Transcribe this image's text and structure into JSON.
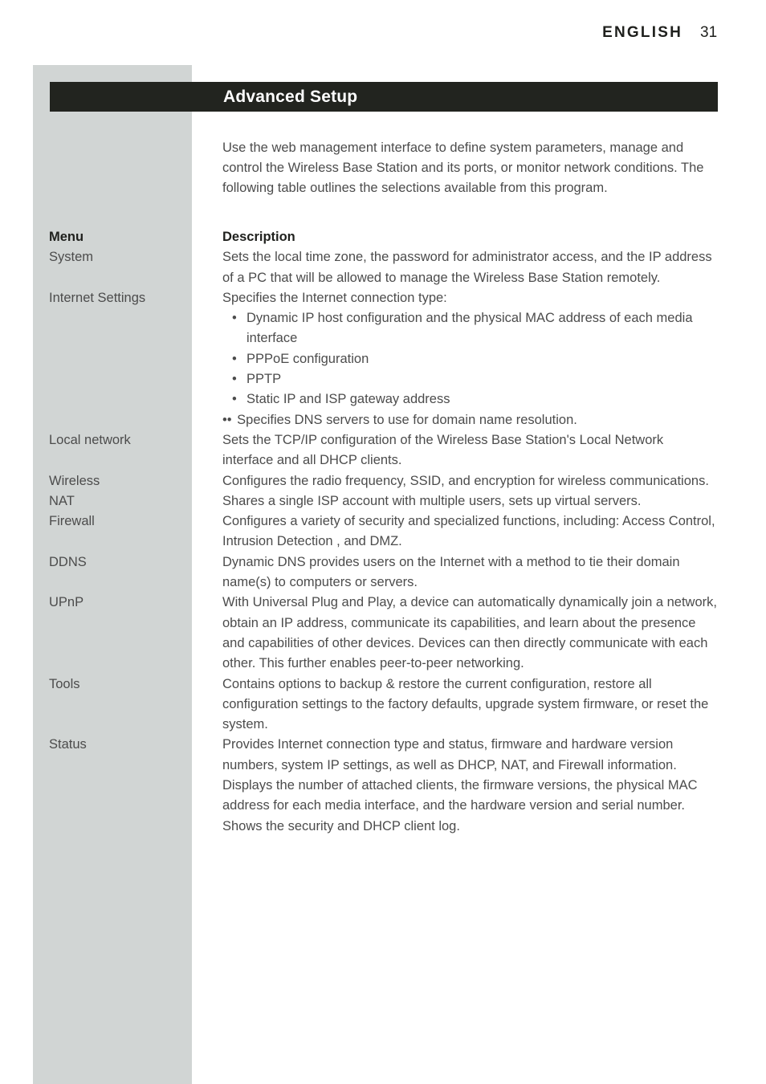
{
  "header": {
    "language": "ENGLISH",
    "page_number": "31"
  },
  "title_bar": {
    "title": "Advanced Setup"
  },
  "intro": {
    "text": "Use the web management interface to define system parameters, manage and control the Wireless Base Station and its ports, or monitor network conditions. The following table outlines the selections available from this program."
  },
  "table": {
    "columns": {
      "menu": "Menu",
      "description": "Description"
    },
    "rows": [
      {
        "menu": "System",
        "paragraphs": [
          "Sets the local time zone, the password for administrator access, and the IP address of a PC that will be allowed to manage the Wireless Base Station remotely."
        ]
      },
      {
        "menu": "Internet Settings",
        "paragraphs": [
          "Specifies the Internet connection type:"
        ],
        "bullets": [
          {
            "marker": "•",
            "text": "Dynamic IP host configuration and the physical MAC address of each media interface",
            "flush": false
          },
          {
            "marker": "•",
            "text": "PPPoE configuration",
            "flush": false
          },
          {
            "marker": "•",
            "text": "PPTP",
            "flush": false
          },
          {
            "marker": "•",
            "text": "Static IP and ISP gateway address",
            "flush": false
          },
          {
            "marker": "••",
            "text": "Specifies DNS servers to use for domain name resolution.",
            "flush": true
          }
        ]
      },
      {
        "menu": "Local network",
        "paragraphs": [
          "Sets the TCP/IP configuration of the Wireless Base Station's Local Network interface and all DHCP clients."
        ]
      },
      {
        "menu": "Wireless",
        "paragraphs": [
          "Configures the radio frequency, SSID, and encryption for wireless communications."
        ]
      },
      {
        "menu": "NAT",
        "paragraphs": [
          "Shares a single ISP account with multiple users, sets up virtual servers."
        ]
      },
      {
        "menu": "Firewall",
        "paragraphs": [
          "Configures a variety of security and specialized functions, including: Access Control, Intrusion Detection , and DMZ."
        ]
      },
      {
        "menu": "DDNS",
        "paragraphs": [
          "Dynamic DNS provides users on the Internet with a method to tie their domain name(s) to computers or servers."
        ]
      },
      {
        "menu": "UPnP",
        "paragraphs": [
          "With Universal Plug and Play, a device can automatically dynamically join a network, obtain an IP address, communicate its capabilities, and learn about the presence and capabilities of other devices. Devices can then directly communicate with each other. This further enables peer-to-peer networking."
        ]
      },
      {
        "menu": "Tools",
        "paragraphs": [
          "Contains options to backup & restore the current configuration, restore all configuration settings to the factory defaults, upgrade system firmware, or reset the system."
        ]
      },
      {
        "menu": "Status",
        "paragraphs": [
          "Provides Internet connection type and status, firmware and hardware version numbers, system IP settings, as well as DHCP, NAT, and Firewall information.",
          "Displays the number of attached clients, the firmware versions, the physical MAC address for each media interface, and the hardware version and serial number.",
          "Shows the security and DHCP client log."
        ]
      }
    ]
  },
  "colors": {
    "title_bar_background": "#22241f",
    "side_band": "#d1d5d4",
    "body_text": "#4c4c4c",
    "heading_text": "#1f201d"
  }
}
